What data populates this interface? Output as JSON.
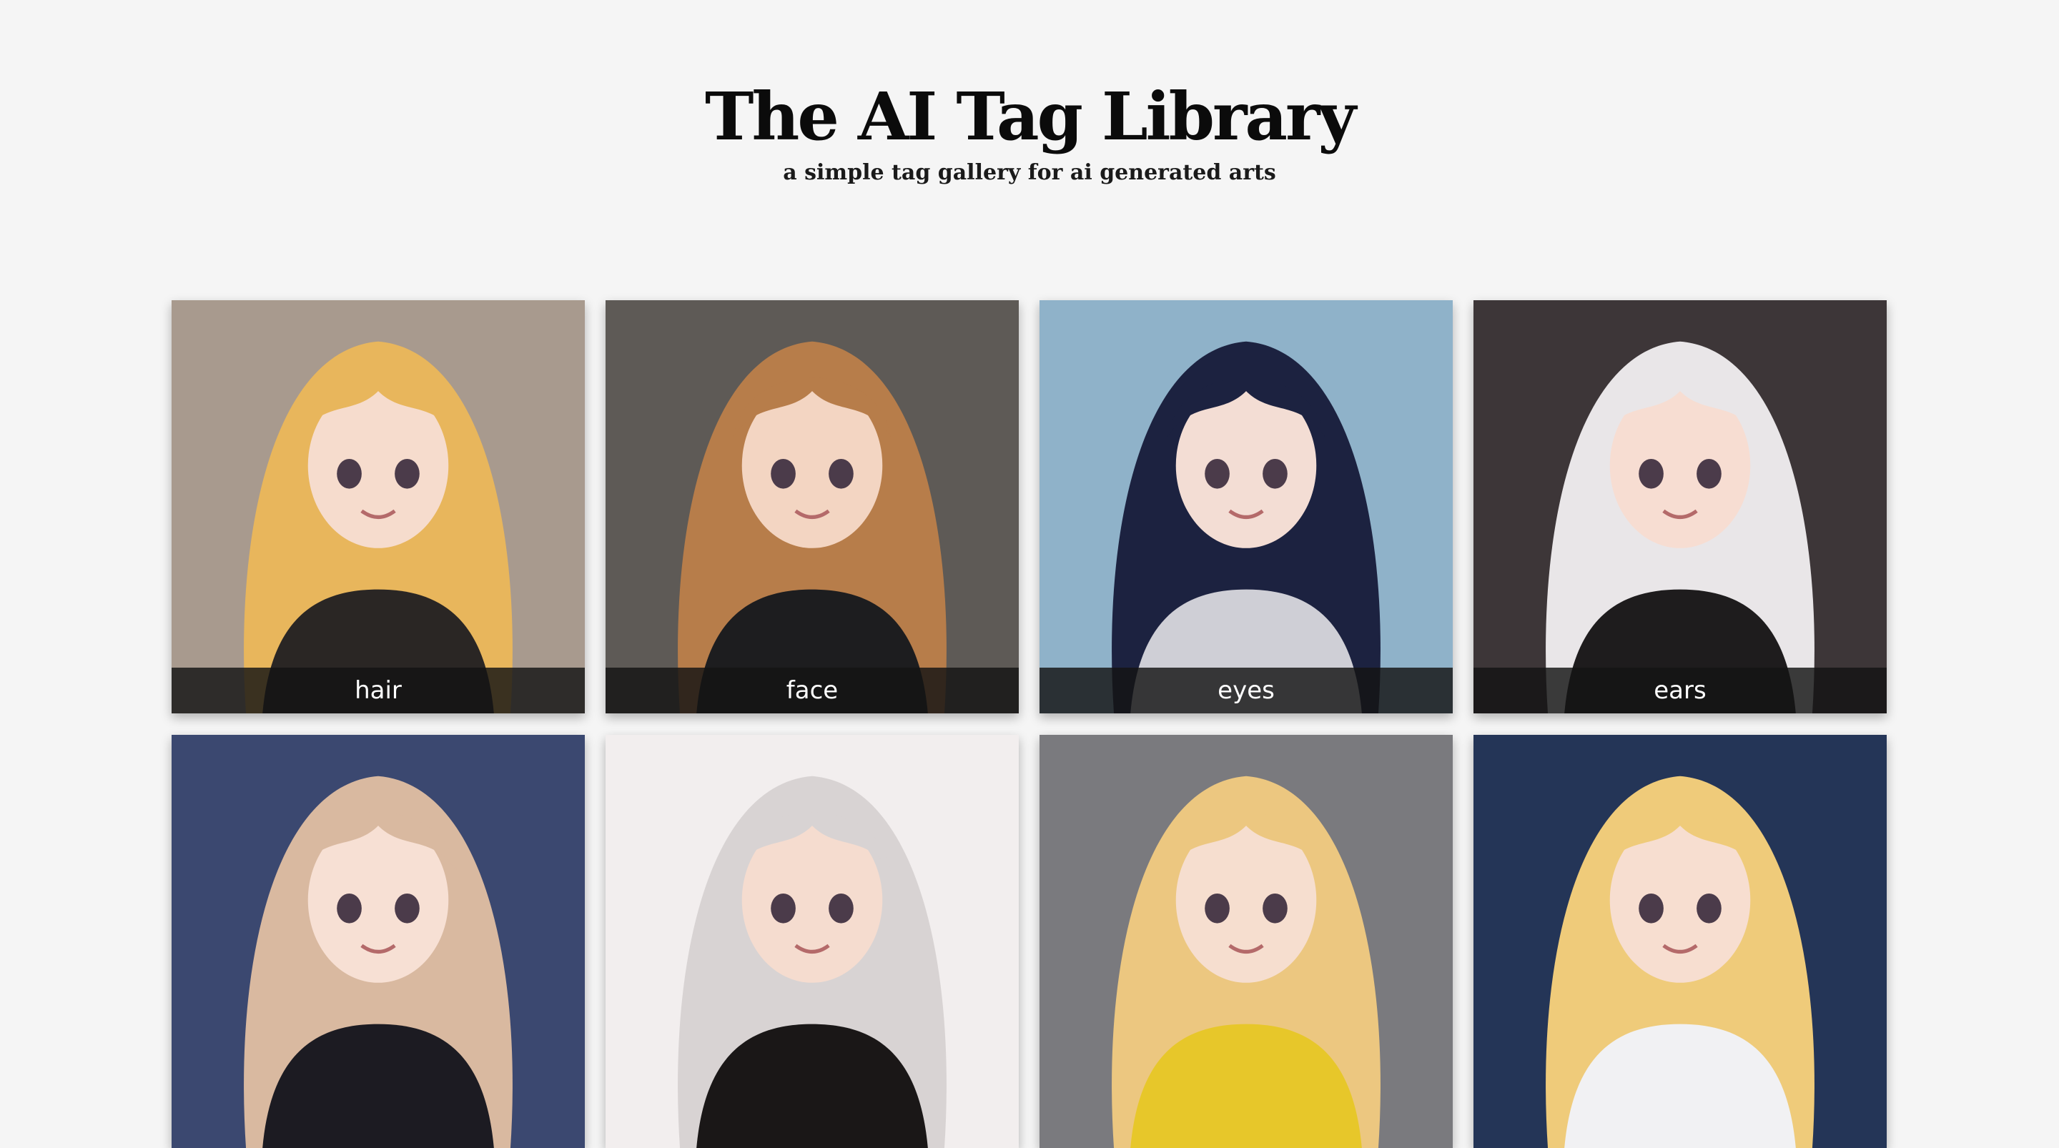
{
  "header": {
    "title": "The AI Tag Library",
    "subtitle": "a simple tag gallery for ai generated arts"
  },
  "gallery": {
    "cards": [
      {
        "label": "hair",
        "hair": "#e8b65c",
        "bg": "#a89a8e",
        "skin": "#f6dccd",
        "outfit": "#2a2624"
      },
      {
        "label": "face",
        "hair": "#b77d4a",
        "bg": "#5e5a56",
        "skin": "#f3d5c2",
        "outfit": "#1d1d1f"
      },
      {
        "label": "eyes",
        "hair": "#1c2240",
        "bg": "#8fb2c9",
        "skin": "#f3ddd4",
        "outfit": "#cfcfd6"
      },
      {
        "label": "ears",
        "hair": "#e9e6e8",
        "bg": "#3d3638",
        "skin": "#f7ddd2",
        "outfit": "#1e1c1d"
      },
      {
        "label": "",
        "hair": "#d9b9a0",
        "bg": "#3b4870",
        "skin": "#f7e0d4",
        "outfit": "#1c1b22"
      },
      {
        "label": "",
        "hair": "#d8d3d3",
        "bg": "#f2eeee",
        "skin": "#f5dccf",
        "outfit": "#1a1717"
      },
      {
        "label": "",
        "hair": "#ecc780",
        "bg": "#7a7a7e",
        "skin": "#f6decf",
        "outfit": "#e7c72a"
      },
      {
        "label": "",
        "hair": "#efcb7a",
        "bg": "#243557",
        "skin": "#f7ded0",
        "outfit": "#f1f1f3"
      }
    ]
  }
}
